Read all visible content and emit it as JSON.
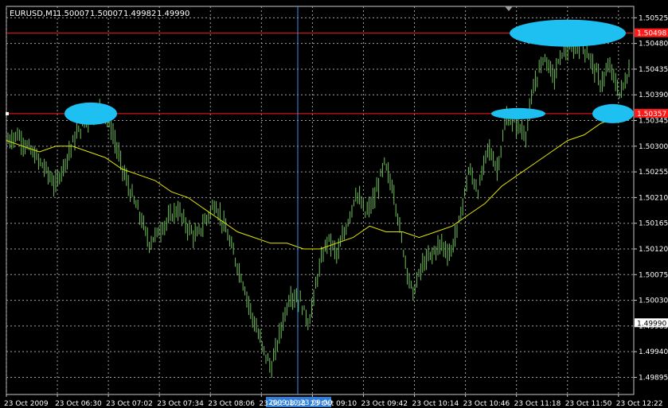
{
  "header": {
    "symbol": "EURUSD,M1",
    "open": "1.50007",
    "high": "1.50007",
    "low": "1.49982",
    "close": "1.49990"
  },
  "crosshair": {
    "time_label": "2009.10.23 09:00"
  },
  "colors": {
    "background": "#000000",
    "grid": "#a0a0a0",
    "price_bars": "#6fbf5a",
    "moving_average": "#e6e600",
    "level_lines": "#ff1a1a",
    "crosshair": "#3b8fe0",
    "highlight_ellipses": "#1ec0f2",
    "axis_text": "#ffffff"
  },
  "chart_data": {
    "type": "line",
    "title": "EURUSD,M1 1.50007 1.50007 1.49982 1.49990",
    "xlabel": "",
    "ylabel": "",
    "ylim": [
      1.49865,
      1.50545
    ],
    "grid": true,
    "y_ticks": [
      "1.50525",
      "1.50480",
      "1.50435",
      "1.50390",
      "1.50345",
      "1.50300",
      "1.50255",
      "1.50210",
      "1.50165",
      "1.50120",
      "1.50075",
      "1.50030",
      "1.49985",
      "1.49940",
      "1.49895"
    ],
    "x_ticks": [
      "23 Oct 2009",
      "23 Oct 06:30",
      "23 Oct 07:02",
      "23 Oct 07:34",
      "23 Oct 08:06",
      "23 Oct 08:38",
      "23 Oct 09:10",
      "23 Oct 09:42",
      "23 Oct 10:14",
      "23 Oct 10:46",
      "23 Oct 11:18",
      "23 Oct 11:50",
      "23 Oct 12:22"
    ],
    "levels": [
      {
        "label": "1.50498",
        "value": 1.50498
      },
      {
        "label": "1.50357",
        "value": 1.50357
      }
    ],
    "current_price": {
      "label": "1.49990",
      "value": 1.4999
    },
    "series": [
      {
        "name": "price",
        "values": [
          1.5031,
          1.5032,
          1.503,
          1.5028,
          1.5026,
          1.5023,
          1.5027,
          1.5031,
          1.5034,
          1.5035,
          1.5037,
          1.5033,
          1.5027,
          1.5022,
          1.5018,
          1.5013,
          1.5015,
          1.5017,
          1.5019,
          1.5016,
          1.5014,
          1.5017,
          1.502,
          1.5016,
          1.5011,
          1.5006,
          1.5,
          1.4995,
          1.4991,
          1.4998,
          1.5004,
          1.5003,
          1.4999,
          1.5008,
          1.5014,
          1.5011,
          1.5016,
          1.5022,
          1.5018,
          1.5021,
          1.5027,
          1.5022,
          1.5012,
          1.5004,
          1.5009,
          1.5011,
          1.5013,
          1.5011,
          1.5017,
          1.5026,
          1.5022,
          1.503,
          1.5026,
          1.5035,
          1.5034,
          1.5032,
          1.5041,
          1.5046,
          1.5042,
          1.5047,
          1.5047,
          1.5048,
          1.5045,
          1.5041,
          1.5044,
          1.5039,
          1.5043
        ]
      },
      {
        "name": "moving average",
        "values": [
          1.5031,
          1.503,
          1.5029,
          1.503,
          1.503,
          1.5029,
          1.5028,
          1.5026,
          1.5025,
          1.5024,
          1.5022,
          1.5021,
          1.5019,
          1.5017,
          1.5015,
          1.5014,
          1.5013,
          1.5013,
          1.5012,
          1.5012,
          1.5013,
          1.5014,
          1.5016,
          1.5015,
          1.5015,
          1.5014,
          1.5015,
          1.5016,
          1.5018,
          1.502,
          1.5023,
          1.5025,
          1.5027,
          1.5029,
          1.5031,
          1.5032,
          1.5034,
          1.5035,
          1.5036
        ]
      }
    ]
  }
}
